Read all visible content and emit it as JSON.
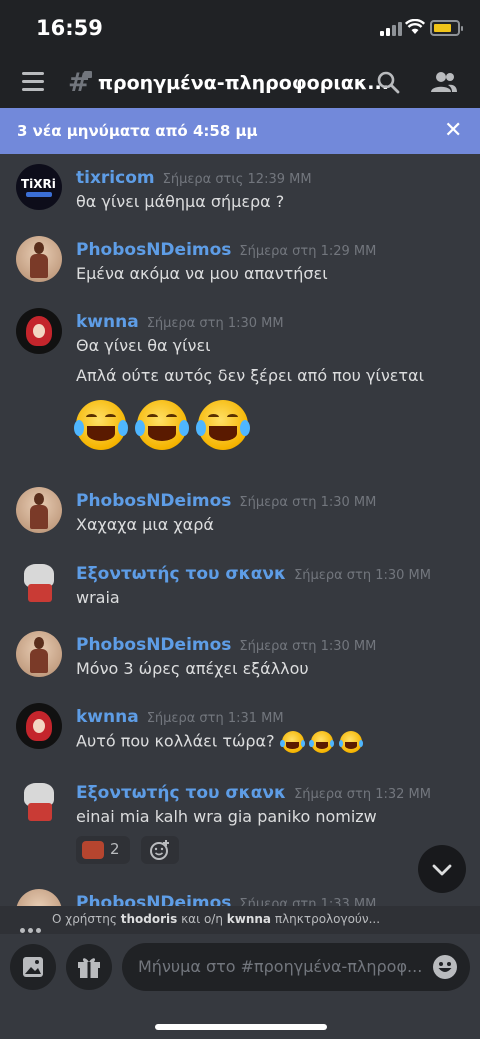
{
  "status_bar": {
    "time": "16:59"
  },
  "header": {
    "channel_name": "προηγμένα-πληροφοριακ..."
  },
  "new_messages_bar": {
    "text": "3 νέα μηνύματα από 4:58 μμ",
    "close": "✕"
  },
  "messages": [
    {
      "author": "tixricom",
      "timestamp": "Σήμερα στις 12:39 ΜΜ",
      "lines": [
        "θα γίνει μάθημα σήμερα ?"
      ],
      "avatar": "tixri-logo",
      "avatar_text": "TiXRi"
    },
    {
      "author": "PhobosNDeimos",
      "timestamp": "Σήμερα στη 1:29 ΜΜ",
      "lines": [
        "Εμένα ακόμα να μου απαντήσει"
      ],
      "avatar": "warrior-avatar"
    },
    {
      "author": "kwnna",
      "timestamp": "Σήμερα στη 1:30 ΜΜ",
      "lines": [
        "Θα γίνει θα γίνει",
        "Απλά ούτε αυτός δεν ξέρει από που γίνεται"
      ],
      "avatar": "red-hair-avatar",
      "emojis": [
        "joy",
        "joy",
        "joy"
      ]
    },
    {
      "author": "PhobosNDeimos",
      "timestamp": "Σήμερα στη 1:30 ΜΜ",
      "lines": [
        "Χαχαχα μια χαρά"
      ],
      "avatar": "warrior-avatar"
    },
    {
      "author": "Εξοντωτής του σκανκ",
      "timestamp": "Σήμερα στη 1:30 ΜΜ",
      "lines": [
        "wraia"
      ],
      "avatar": "cat-avatar"
    },
    {
      "author": "PhobosNDeimos",
      "timestamp": "Σήμερα στη 1:30 ΜΜ",
      "lines": [
        "Μόνο 3 ώρες απέχει εξάλλου"
      ],
      "avatar": "warrior-avatar"
    },
    {
      "author": "kwnna",
      "timestamp": "Σήμερα στη 1:31 ΜΜ",
      "lines": [
        "Αυτό που κολλάει τώρα?"
      ],
      "avatar": "red-hair-avatar",
      "inline_emojis": [
        "joy",
        "joy",
        "joy"
      ]
    },
    {
      "author": "Εξοντωτής του σκανκ",
      "timestamp": "Σήμερα στη 1:32 ΜΜ",
      "lines": [
        "einai mia kalh wra gia paniko nomizw"
      ],
      "avatar": "cat-avatar",
      "reaction_count": "2"
    },
    {
      "author": "PhobosNDeimos",
      "timestamp": "Σήμερα στη 1:33 ΜΜ",
      "lines": [],
      "avatar": "warrior-avatar"
    }
  ],
  "typing": {
    "prefix": "Ο χρήστης",
    "user1": "thodoris",
    "middle": "και ο/η",
    "user2": "kwnna",
    "suffix": "πληκτρολογούν..."
  },
  "composer": {
    "placeholder": "Μήνυμα στο #προηγμένα-πληροφ..."
  },
  "colors": {
    "background": "#36393f",
    "header": "#202225",
    "accent": "#7289da",
    "author": "#5e9de6"
  }
}
